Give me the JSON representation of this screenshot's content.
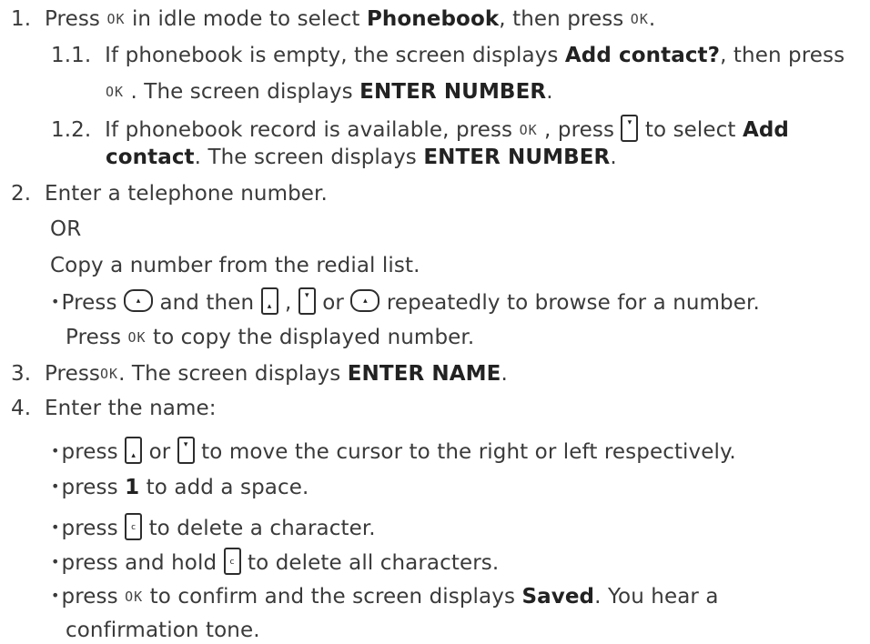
{
  "ok_label": "OK",
  "steps": {
    "s1": {
      "number": "1.",
      "a": "Press",
      "b": "in idle mode to select",
      "c": "Phonebook",
      "d": ", then press",
      "e": "."
    },
    "s1_1": {
      "number": "1.1.",
      "a": "If phonebook is empty, the screen displays",
      "b": "Add contact?",
      "c": ", then press",
      "d": ". The screen displays",
      "e": "ENTER NUMBER",
      "f": "."
    },
    "s1_2": {
      "number": "1.2.",
      "a": "If phonebook record is available, press",
      "b": ", press",
      "c": "to select",
      "d": "Add",
      "e": "contact",
      "f": ". The screen displays",
      "g": "ENTER NUMBER",
      "h": "."
    },
    "s2": {
      "number": "2.",
      "a": "Enter a telephone number.",
      "or": "OR",
      "b": "Copy a number from the redial list.",
      "bullet_a": "Press",
      "bullet_b": "and then",
      "bullet_c": ",",
      "bullet_d": "or",
      "bullet_e": "repeatedly to browse for a number.",
      "bullet_f": "Press",
      "bullet_g": "to copy the displayed number."
    },
    "s3": {
      "number": "3.",
      "a": "Press",
      "b": ". The screen displays",
      "c": "ENTER NAME",
      "d": "."
    },
    "s4": {
      "number": "4.",
      "a": "Enter the name:",
      "b1_a": "press",
      "b1_b": "or",
      "b1_c": "to move the cursor to the right or left respectively.",
      "b2_a": "press",
      "b2_b": "1",
      "b2_c": "to add a space.",
      "b3_a": "press",
      "b3_b": "to delete a character.",
      "b4_a": "press and hold",
      "b4_b": "to delete all characters.",
      "b5_a": "press",
      "b5_b": "to confirm and the screen displays",
      "b5_c": "Saved",
      "b5_d": ". You hear a",
      "b5_e": "confirmation tone."
    }
  },
  "key_glyphs": {
    "up": "▴",
    "down": "▾",
    "clear": "c",
    "redial": "▴"
  },
  "icons": {
    "ok_key": "ok-key-icon",
    "up_key": "up-arrow-key-icon",
    "down_key": "down-arrow-key-icon",
    "redial_key": "redial-key-icon",
    "clear_key": "clear-key-icon"
  }
}
